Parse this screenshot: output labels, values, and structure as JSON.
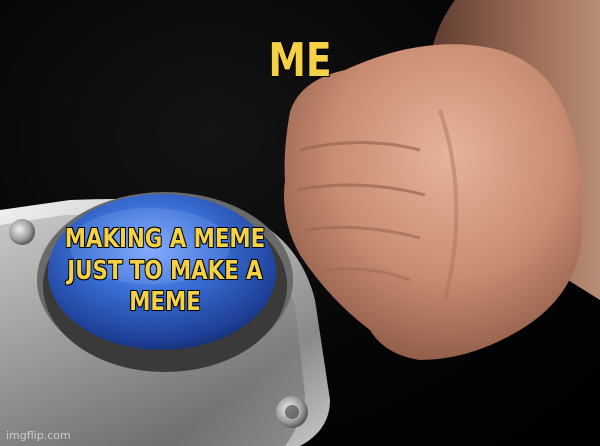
{
  "captions": {
    "top": "ME",
    "button": "MAKING A MEME JUST TO MAKE A MEME"
  },
  "watermark": "imgflip.com",
  "colors": {
    "caption": "#f5d245",
    "button": "#3b6fd6",
    "background": "#000000"
  }
}
